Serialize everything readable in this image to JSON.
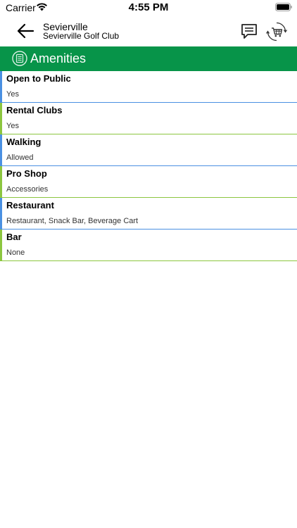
{
  "status_bar": {
    "carrier": "Carrier",
    "time": "4:55 PM"
  },
  "nav": {
    "title": "Sevierville",
    "subtitle": "Sevierville Golf Club",
    "back_icon": "arrow-left-icon",
    "chat_icon": "chat-bubble-icon",
    "cart_icon": "cart-sync-icon"
  },
  "section": {
    "title": "Amenities",
    "icon": "list-document-icon"
  },
  "colors": {
    "brand_green": "#079449",
    "accent_blue": "#4a90e2",
    "accent_green": "#8cc63f"
  },
  "amenities": [
    {
      "name": "Open to Public",
      "value": "Yes",
      "accent": "blue"
    },
    {
      "name": "Rental Clubs",
      "value": "Yes",
      "accent": "green"
    },
    {
      "name": "Walking",
      "value": "Allowed",
      "accent": "blue"
    },
    {
      "name": "Pro Shop",
      "value": "Accessories",
      "accent": "green"
    },
    {
      "name": "Restaurant",
      "value": "Restaurant, Snack Bar, Beverage Cart",
      "accent": "blue"
    },
    {
      "name": "Bar",
      "value": "None",
      "accent": "green"
    }
  ]
}
